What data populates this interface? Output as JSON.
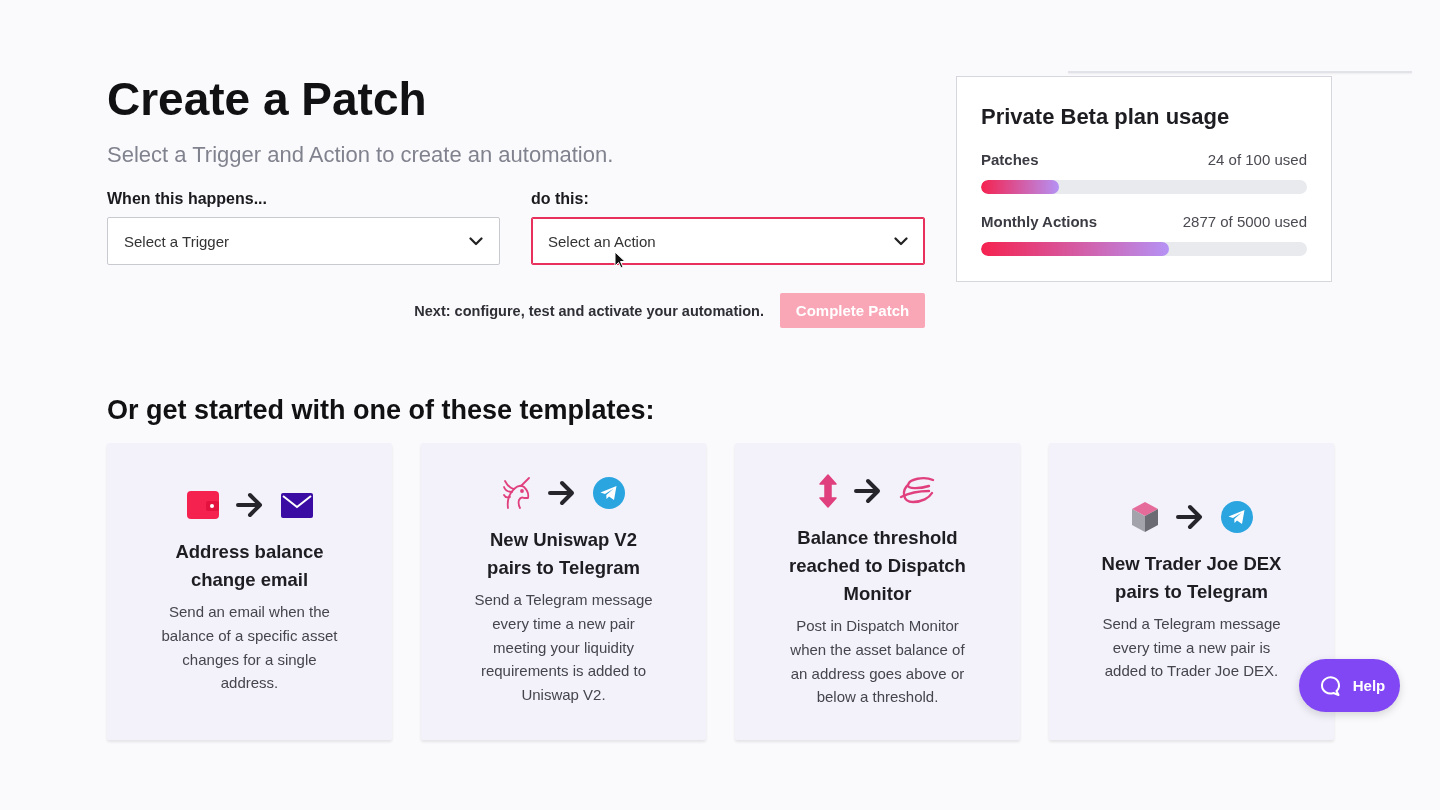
{
  "page": {
    "title": "Create a Patch",
    "subtitle": "Select a Trigger and Action to create an automation."
  },
  "selectors": [
    {
      "label": "When this happens...",
      "placeholder": "Select a Trigger",
      "focused": false
    },
    {
      "label": "do this:",
      "placeholder": "Select an Action",
      "focused": true
    }
  ],
  "next_step": {
    "hint": "Next: configure, test and activate your automation.",
    "button": {
      "label": "Complete Patch",
      "disabled": true
    }
  },
  "usage": {
    "title": "Private Beta plan usage",
    "meters": [
      {
        "name": "Patches",
        "reading": "24 of 100 used",
        "level": 0.24
      },
      {
        "name": "Monthly Actions",
        "reading": "2877 of 5000 used",
        "level": 0.5754
      }
    ]
  },
  "templates": {
    "heading": "Or get started with one of these templates:",
    "cards": [
      {
        "icons": [
          {
            "kind": "wallet"
          },
          {
            "kind": "envelope"
          }
        ],
        "title": "Address balance change email",
        "description": "Send an email when the balance of a specific asset changes for a single address."
      },
      {
        "icons": [
          {
            "kind": "unicorn"
          },
          {
            "kind": "paper-plane"
          }
        ],
        "title": "New Uniswap V2 pairs to Telegram",
        "description": "Send a Telegram message every time a new pair meeting your liquidity requirements is added to Uniswap V2."
      },
      {
        "icons": [
          {
            "kind": "up-down-arrow"
          },
          {
            "kind": "scribble"
          }
        ],
        "title": "Balance threshold reached to Dispatch Monitor",
        "description": "Post in Dispatch Monitor when the asset balance of an address goes above or below a threshold."
      },
      {
        "icons": [
          {
            "kind": "cube"
          },
          {
            "kind": "paper-plane"
          }
        ],
        "title": "New Trader Joe DEX pairs to Telegram",
        "description": "Send a Telegram message every time a new pair is added to Trader Joe DEX."
      }
    ]
  },
  "help_button": {
    "label": "Help"
  }
}
